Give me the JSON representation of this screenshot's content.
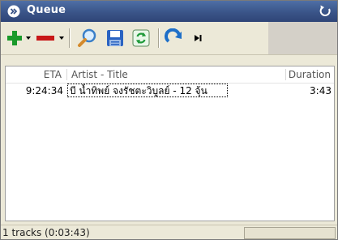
{
  "window": {
    "title": "Queue",
    "icons": {
      "title_icon": "chevron-double-icon",
      "close": "back-arrow-icon"
    }
  },
  "toolbar": {
    "items": [
      {
        "name": "add",
        "icon": "plus-icon",
        "color": "#1a9a2a",
        "has_dropdown": true
      },
      {
        "name": "remove",
        "icon": "minus-icon",
        "color": "#c81818",
        "has_dropdown": true
      },
      {
        "name": "search",
        "icon": "magnifier-icon"
      },
      {
        "name": "save",
        "icon": "floppy-disk-icon"
      },
      {
        "name": "refresh",
        "icon": "refresh-icon"
      },
      {
        "name": "repeat",
        "icon": "repeat-arrow-icon"
      },
      {
        "name": "play-next",
        "icon": "skip-icon"
      }
    ]
  },
  "list": {
    "columns": {
      "eta": "ETA",
      "title": "Artist - Title",
      "duration": "Duration"
    },
    "rows": [
      {
        "eta": "9:24:34",
        "title": "บี น้ำทิพย์ จงรัชตะวิบูลย์ - 12 จุ้น",
        "duration": "3:43"
      }
    ]
  },
  "status": {
    "text": "1 tracks (0:03:43)"
  }
}
